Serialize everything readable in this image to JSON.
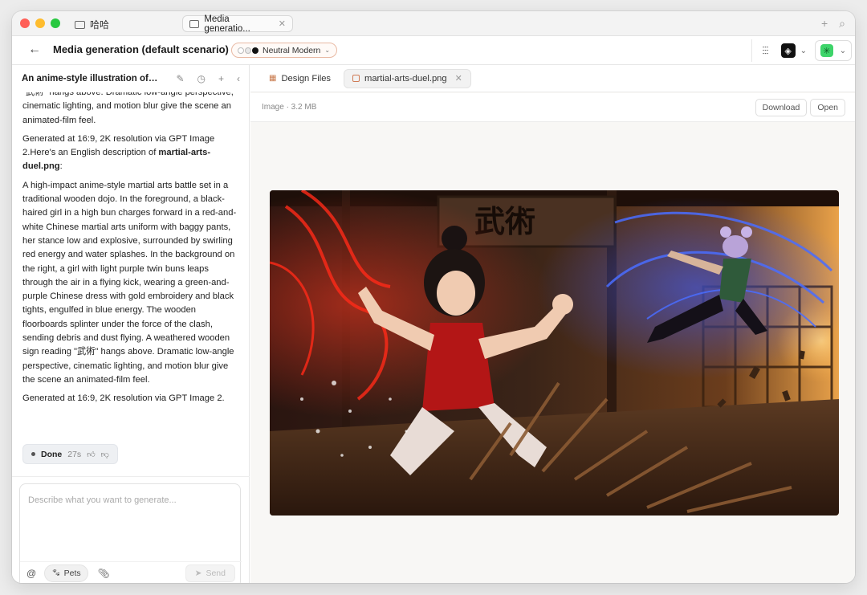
{
  "window": {
    "folder_name": "哈哈",
    "tab_title": "Media generatio..."
  },
  "header": {
    "title": "Media generation (default scenario)",
    "theme_label": "Neutral Modern"
  },
  "conversation": {
    "title": "An anime-style illustration of a...",
    "paragraphs": {
      "p1": "\"武術\" hangs above. Dramatic low-angle perspective, cinematic lighting, and motion blur give the scene an animated-film feel.",
      "p2_prefix": "Generated at 16:9, 2K resolution via GPT Image 2.Here's an English description of ",
      "p2_file": "martial-arts-duel.png",
      "p2_suffix": ":",
      "p3": "A high-impact anime-style martial arts battle set in a traditional wooden dojo. In the foreground, a black-haired girl in a high bun charges forward in a red-and-white Chinese martial arts uniform with baggy pants, her stance low and explosive, surrounded by swirling red energy and water splashes. In the background on the right, a girl with light purple twin buns leaps through the air in a flying kick, wearing a green-and-purple Chinese dress with gold embroidery and black tights, engulfed in blue energy. The wooden floorboards splinter under the force of the clash, sending debris and dust flying. A weathered wooden sign reading \"武術\" hangs above. Dramatic low-angle perspective, cinematic lighting, and motion blur give the scene an animated-film feel.",
      "p4": "Generated at 16:9, 2K resolution via GPT Image 2."
    },
    "status": {
      "label": "Done",
      "duration": "27s"
    }
  },
  "composer": {
    "placeholder": "Describe what you want to generate...",
    "pets_label": "Pets",
    "send_label": "Send"
  },
  "preview": {
    "tabs": [
      {
        "label": "Design Files"
      },
      {
        "label": "martial-arts-duel.png"
      }
    ],
    "file_meta": "Image · 3.2 MB",
    "download_label": "Download",
    "open_label": "Open",
    "sign_text": "武術"
  },
  "icons": {
    "back": "arrow-left-icon",
    "sliders": "sliders-icon",
    "edit": "pencil-icon",
    "history": "history-icon",
    "add": "plus-icon",
    "collapse": "chevron-left-icon"
  },
  "colors": {
    "accent": "#d07b55",
    "avatar": "#3ed46a",
    "energy_red": "#e02a1c",
    "energy_blue": "#3b5bff"
  }
}
